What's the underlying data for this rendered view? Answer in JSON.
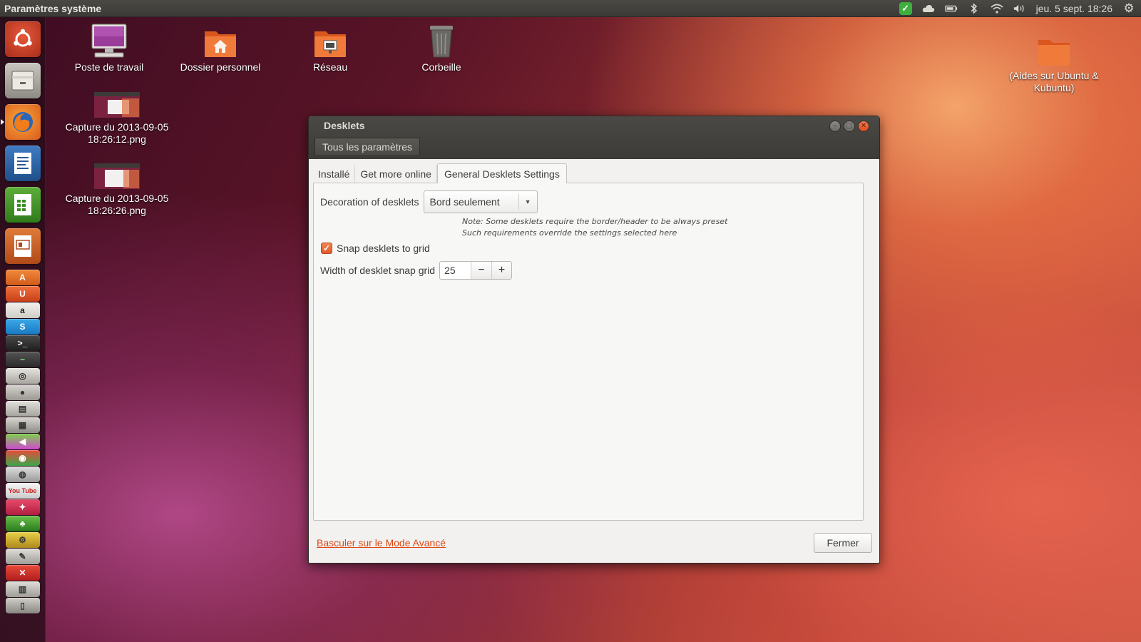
{
  "top_panel": {
    "app_title": "Paramètres système",
    "clock": "jeu. 5 sept. 18:26"
  },
  "desktop_icons": {
    "computer": "Poste de travail",
    "home": "Dossier personnel",
    "network": "Réseau",
    "trash": "Corbeille",
    "capture1": "Capture du 2013-09-05 18:26:12.png",
    "capture2": "Capture du 2013-09-05 18:26:26.png",
    "help_folder": "(Aides sur Ubuntu & Kubuntu)"
  },
  "window": {
    "title": "Desklets",
    "all_settings": "Tous les paramètres",
    "tabs": [
      "Installé",
      "Get more online",
      "General Desklets Settings"
    ],
    "decoration_label": "Decoration of desklets",
    "decoration_value": "Bord seulement",
    "note_line1": "Note: Some desklets require the border/header to be always preset",
    "note_line2": "Such requirements override the settings selected here",
    "snap_label": "Snap desklets to grid",
    "width_label": "Width of desklet snap grid",
    "width_value": "25",
    "minus": "−",
    "plus": "+",
    "advanced_link": "Basculer sur le Mode Avancé",
    "close_button": "Fermer"
  },
  "launcher": {
    "amazon_letter": "a",
    "youtube_label": "You Tube"
  },
  "colors": {
    "accent": "#dd4814",
    "panel_bg": "#3c3b37"
  }
}
